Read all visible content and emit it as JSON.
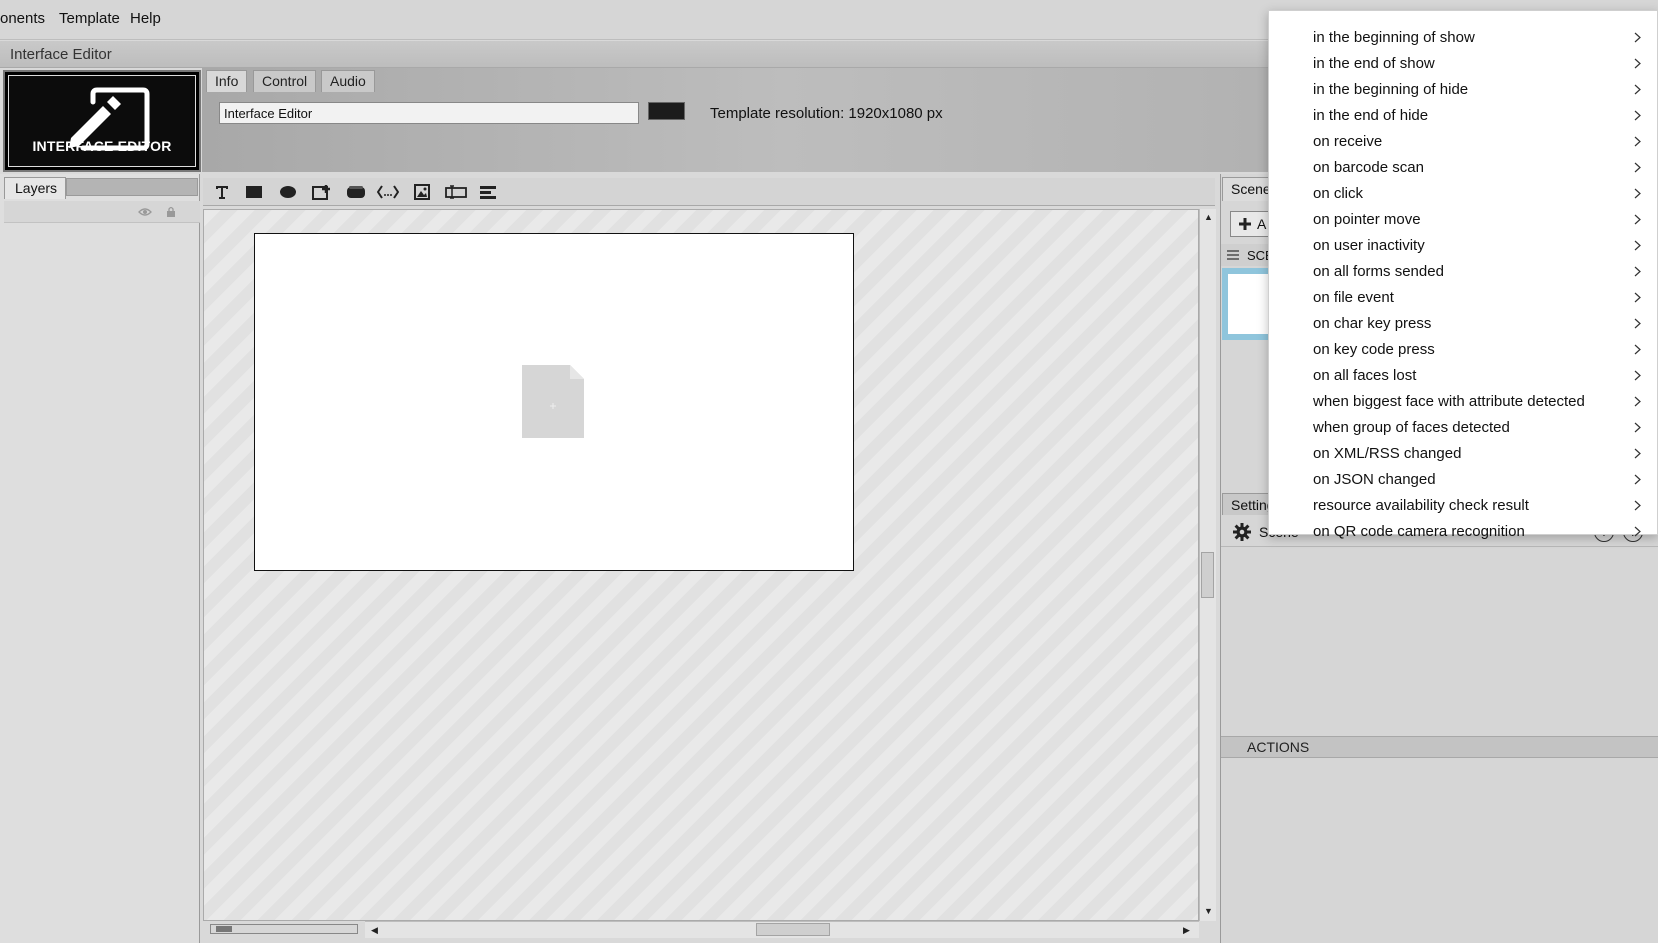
{
  "menubar": {
    "items": [
      {
        "label": "onents"
      },
      {
        "label": "Template"
      },
      {
        "label": "Help"
      }
    ]
  },
  "window": {
    "title": "Interface Editor"
  },
  "logo": {
    "caption": "INTERFACE EDITOR"
  },
  "header": {
    "tabs": [
      {
        "label": "Info",
        "active": true
      },
      {
        "label": "Control",
        "active": false
      },
      {
        "label": "Audio",
        "active": false
      }
    ],
    "name_value": "Interface Editor",
    "swatch_color": "#1c1c1c",
    "resolution_text": "Template resolution: 1920x1080 px"
  },
  "layers": {
    "tab_label": "Layers"
  },
  "toolbar": {
    "icons": [
      "text-tool-icon",
      "rectangle-tool-icon",
      "ellipse-tool-icon",
      "add-frame-tool-icon",
      "button-tool-icon",
      "html-tool-icon",
      "image-tool-icon",
      "input-tool-icon",
      "align-tool-icon"
    ]
  },
  "right_panel": {
    "scenes_tab": "Scene",
    "add_label": "A",
    "scene_label": "SCE",
    "settings_tab": "Setting",
    "settings_title": "Scene",
    "actions_label": "ACTIONS"
  },
  "context_menu": {
    "items": [
      {
        "label": "in the beginning of show"
      },
      {
        "label": "in the end of show"
      },
      {
        "label": "in the beginning of hide"
      },
      {
        "label": "in the end of hide"
      },
      {
        "label": "on receive"
      },
      {
        "label": "on barcode scan"
      },
      {
        "label": "on click"
      },
      {
        "label": "on pointer move"
      },
      {
        "label": "on user inactivity"
      },
      {
        "label": "on all forms sended"
      },
      {
        "label": "on file event"
      },
      {
        "label": "on char key press"
      },
      {
        "label": "on key code press"
      },
      {
        "label": "on all faces lost"
      },
      {
        "label": "when biggest face with attribute detected"
      },
      {
        "label": "when group of faces detected"
      },
      {
        "label": "on XML/RSS changed"
      },
      {
        "label": "on JSON changed"
      },
      {
        "label": "resource availability check result"
      },
      {
        "label": "on QR code camera recognition"
      }
    ]
  },
  "colors": {
    "accent_selection": "#8fc5dc",
    "canvas_stripe": "#e1e1e1"
  }
}
